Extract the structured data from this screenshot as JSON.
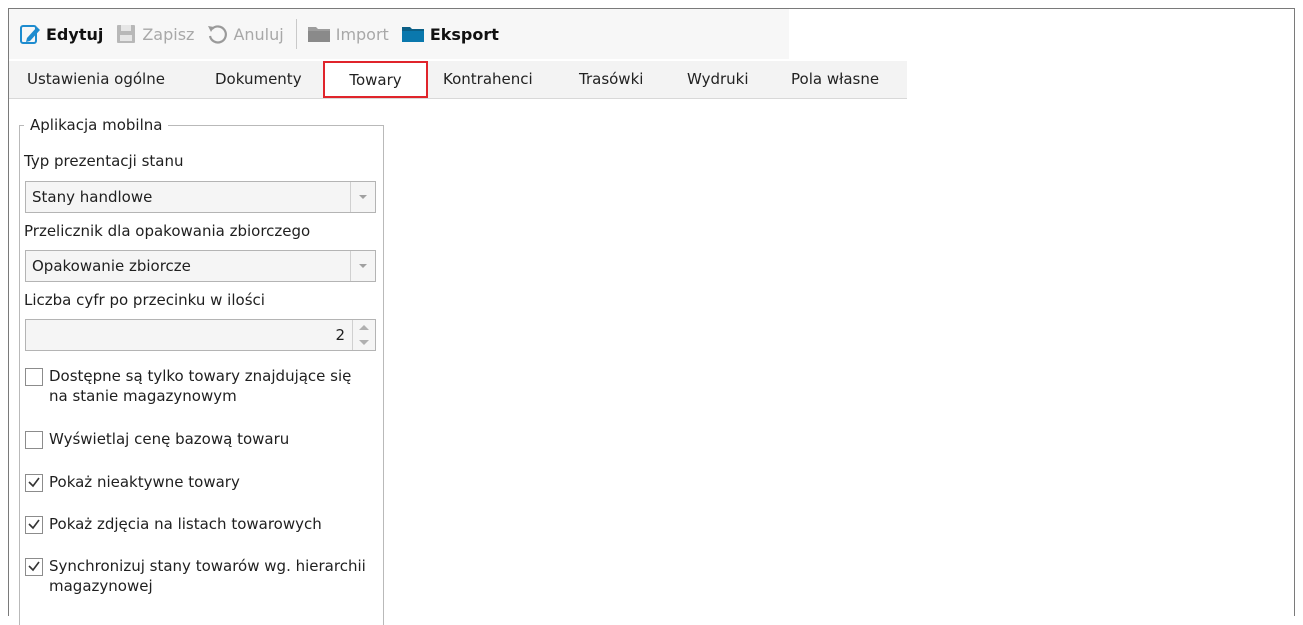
{
  "toolbar": {
    "edit_label": "Edytuj",
    "save_label": "Zapisz",
    "cancel_label": "Anuluj",
    "import_label": "Import",
    "export_label": "Eksport"
  },
  "tabs": [
    {
      "label": "Ustawienia ogólne"
    },
    {
      "label": "Dokumenty"
    },
    {
      "label": "Towary",
      "selected": true
    },
    {
      "label": "Kontrahenci"
    },
    {
      "label": "Trasówki"
    },
    {
      "label": "Wydruki"
    },
    {
      "label": "Pola własne"
    }
  ],
  "group": {
    "title": "Aplikacja mobilna",
    "stock_type": {
      "label": "Typ prezentacji stanu",
      "value": "Stany handlowe"
    },
    "converter": {
      "label": "Przelicznik dla opakowania zbiorczego",
      "value": "Opakowanie zbiorcze"
    },
    "decimals": {
      "label": "Liczba cyfr po przecinku w ilości",
      "value": "2"
    },
    "checkboxes": [
      {
        "label": "Dostępne są tylko towary znajdujące się na stanie magazynowym",
        "checked": false
      },
      {
        "label": "Wyświetlaj cenę bazową towaru",
        "checked": false
      },
      {
        "label": "Pokaż nieaktywne towary",
        "checked": true
      },
      {
        "label": "Pokaż zdjęcia na listach towarowych",
        "checked": true
      },
      {
        "label": "Synchronizuj stany towarów wg. hierarchii magazynowej",
        "checked": true
      }
    ]
  },
  "colors": {
    "accent_blue": "#1e8ccf",
    "highlight_red": "#e0242b",
    "folder_dark": "#0b5f86"
  },
  "icons": {
    "edit": "edit-icon",
    "save": "save-icon",
    "cancel": "undo-icon",
    "import": "folder-icon",
    "export": "folder-icon"
  }
}
